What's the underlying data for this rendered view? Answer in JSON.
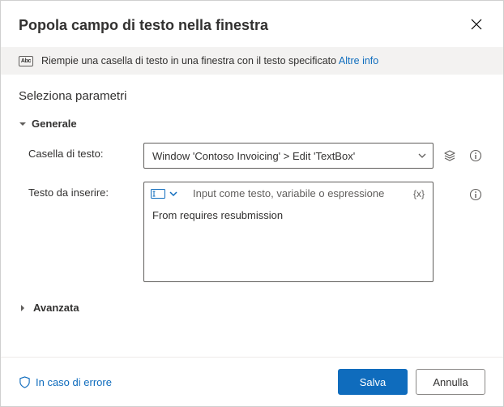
{
  "header": {
    "title": "Popola campo di testo nella finestra"
  },
  "info": {
    "icon_label": "Abc",
    "text": "Riempie una casella di testo in una finestra con il testo specificato",
    "link": "Altre info"
  },
  "section": {
    "title": "Seleziona parametri"
  },
  "groups": {
    "general": {
      "label": "Generale",
      "fields": {
        "textbox": {
          "label": "Casella di testo:",
          "value": "Window 'Contoso Invoicing' > Edit 'TextBox'"
        },
        "text_to_insert": {
          "label": "Testo da inserire:",
          "placeholder": "Input come testo, variabile o espressione",
          "fx_label": "{x}",
          "value": "From requires resubmission"
        }
      }
    },
    "advanced": {
      "label": "Avanzata"
    }
  },
  "footer": {
    "error_link": "In caso di errore",
    "save": "Salva",
    "cancel": "Annulla"
  }
}
